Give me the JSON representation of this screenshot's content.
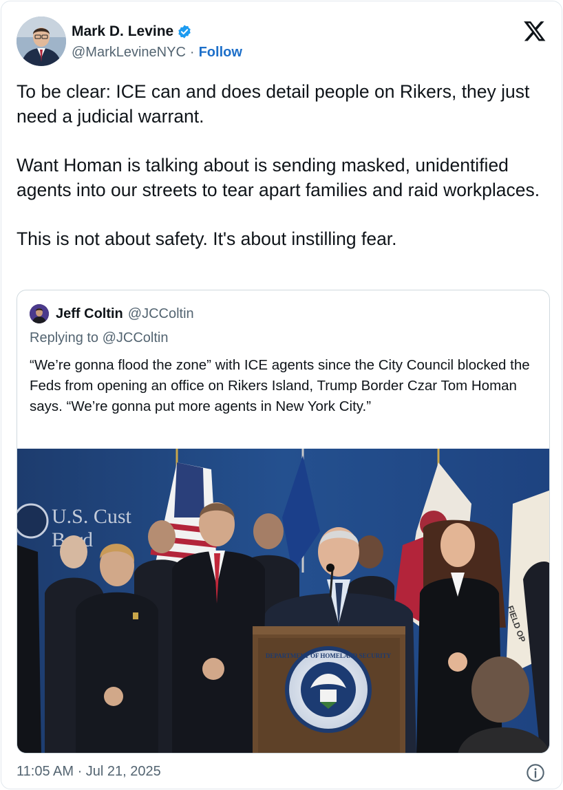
{
  "author": {
    "name": "Mark D. Levine",
    "handle": "@MarkLevineNYC",
    "separator": "·",
    "follow_label": "Follow"
  },
  "tweet": {
    "paragraphs": [
      "To be clear: ICE can and does detail people on Rikers, they just need a judicial warrant.",
      "Want Homan is talking about is sending masked, unidentified agents into our streets to tear apart families and raid workplaces.",
      "This is not about safety. It's about instilling fear."
    ],
    "timestamp": "11:05 AM · Jul 21, 2025"
  },
  "quote": {
    "name": "Jeff Coltin",
    "handle": "@JCColtin",
    "reply_context": "Replying to @JCColtin",
    "text": "“We’re gonna flood the zone” with ICE agents since the City Council blocked the Feds from opening an office on Rikers Island, Trump Border Czar Tom Homan says. “We’re gonna put more agents in New York City.”"
  },
  "photo": {
    "wall_text_1": "U.S. Cust",
    "wall_text_2": "Bord",
    "seal_text": "DEPARTMENT OF HOMELAND SECURITY",
    "flag_text": "FIELD OP"
  },
  "icons": {
    "verified": "verified-badge-icon",
    "x": "x-logo-icon",
    "info": "info-icon"
  },
  "colors": {
    "accent": "#1d9bf0",
    "follow": "#1d6fc9",
    "secondary_text": "#536471",
    "border": "#cfd9de"
  }
}
